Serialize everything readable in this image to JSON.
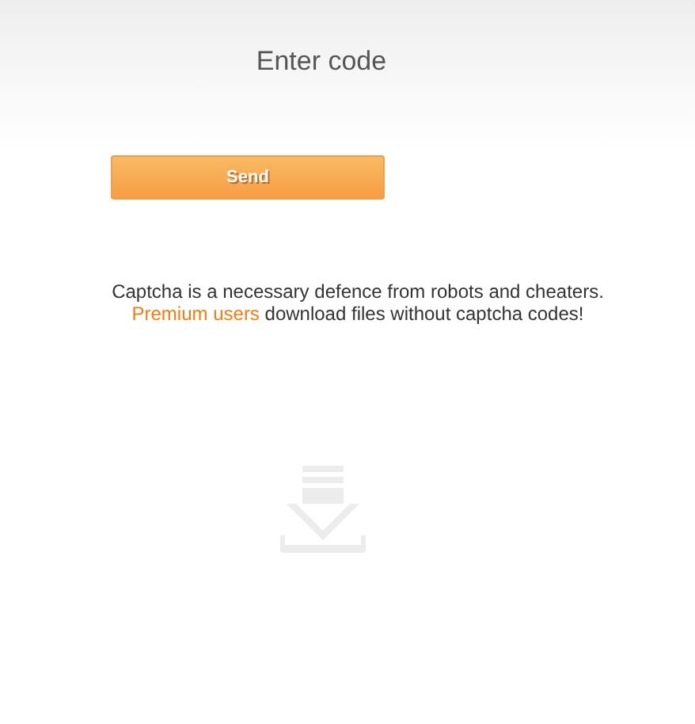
{
  "title": "Enter code",
  "send_button": "Send",
  "note": {
    "line_1": "Captcha is a necessary defence from robots and cheaters.",
    "link": "Premium users",
    "rest": " download files without captcha codes!"
  }
}
